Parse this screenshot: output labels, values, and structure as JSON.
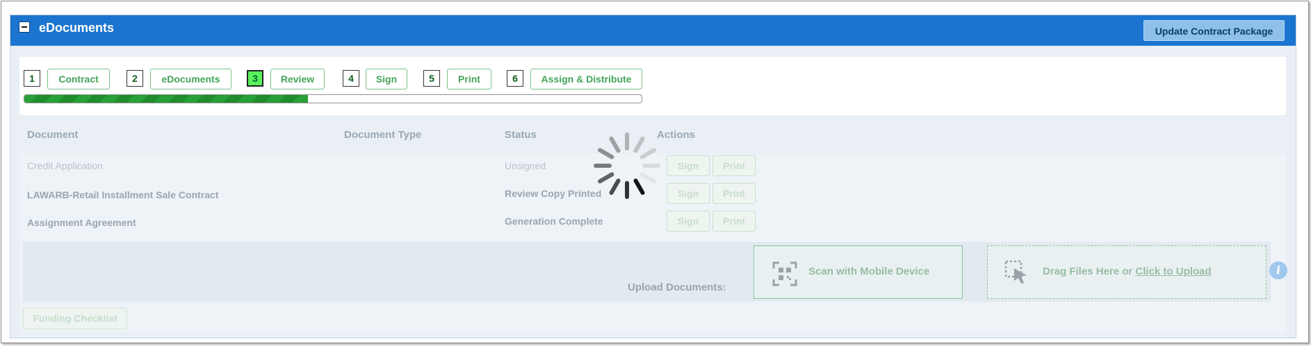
{
  "panel": {
    "title": "eDocuments",
    "update_button": "Update Contract Package"
  },
  "steps": [
    {
      "num": "1",
      "label": "Contract",
      "active": false
    },
    {
      "num": "2",
      "label": "eDocuments",
      "active": false
    },
    {
      "num": "3",
      "label": "Review",
      "active": true
    },
    {
      "num": "4",
      "label": "Sign",
      "active": false
    },
    {
      "num": "5",
      "label": "Print",
      "active": false
    },
    {
      "num": "6",
      "label": "Assign & Distribute",
      "active": false
    }
  ],
  "progress": {
    "fraction": 0.46
  },
  "table": {
    "headers": {
      "document": "Document",
      "type": "Document Type",
      "status": "Status",
      "actions": "Actions"
    },
    "rows": [
      {
        "document": "Credit Application",
        "type": "",
        "status": "Unsigned",
        "sign": "Sign",
        "print": "Print"
      },
      {
        "document": "LAWARB-Retail Installment Sale Contract",
        "type": "",
        "status": "Review Copy Printed",
        "sign": "Sign",
        "print": "Print"
      },
      {
        "document": "Assignment Agreement",
        "type": "",
        "status": "Generation Complete",
        "sign": "Sign",
        "print": "Print"
      }
    ]
  },
  "upload": {
    "label": "Upload Documents:",
    "scan_label": "Scan with Mobile Device",
    "drop_prefix": "Drag Files Here or ",
    "drop_link": "Click to Upload",
    "info_glyph": "i"
  },
  "funding_button": "Funding Checklist",
  "colors": {
    "header_blue": "#1b75d0",
    "progress_green": "#26a136",
    "active_step": "#5cf05c"
  },
  "icons": [
    "collapse-icon",
    "qr-code-icon",
    "drag-drop-icon",
    "info-icon",
    "loading-spinner"
  ]
}
